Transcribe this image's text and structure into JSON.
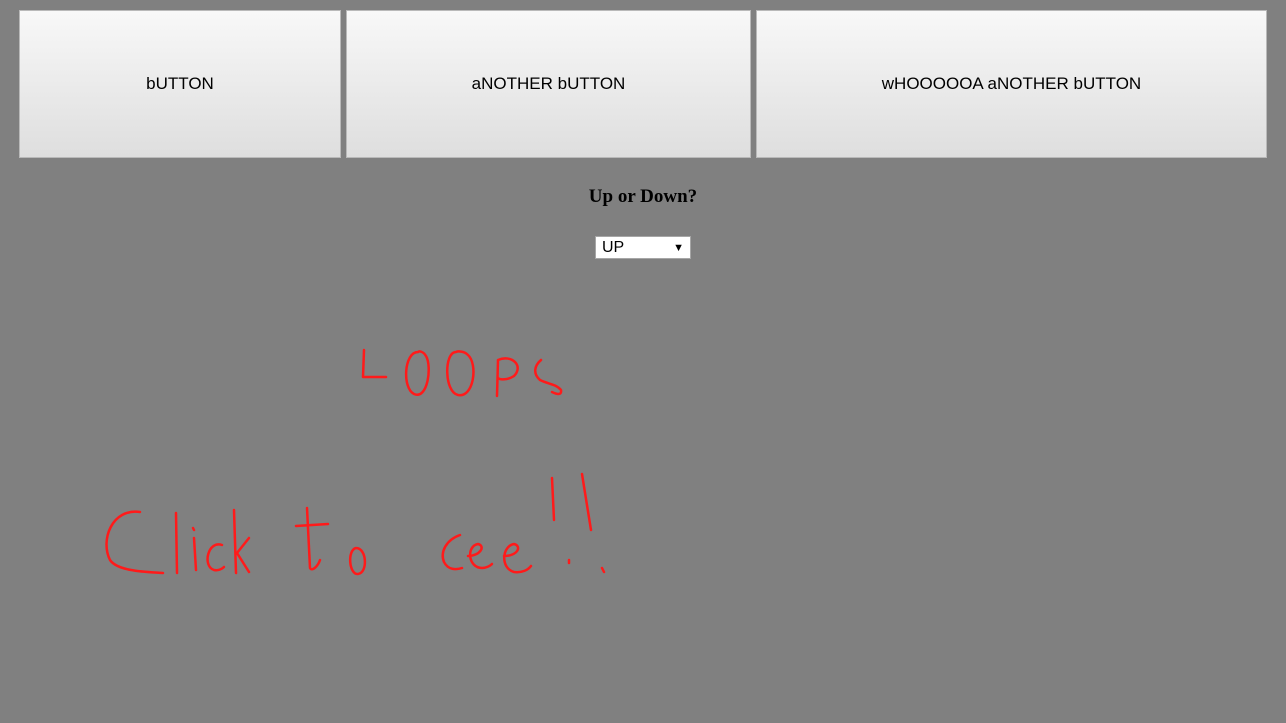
{
  "buttons": [
    {
      "label": "bUTTON"
    },
    {
      "label": "aNOTHER bUTTON"
    },
    {
      "label": "wHOOOOOA aNOTHER bUTTON"
    }
  ],
  "question": {
    "text": "Up or Down?"
  },
  "direction_select": {
    "selected": "UP",
    "arrow": "▼"
  },
  "annotation": {
    "line1": "LOOPS",
    "line2": "Click to see!!",
    "color": "#ff1a1a"
  },
  "colors": {
    "background": "#808080"
  }
}
